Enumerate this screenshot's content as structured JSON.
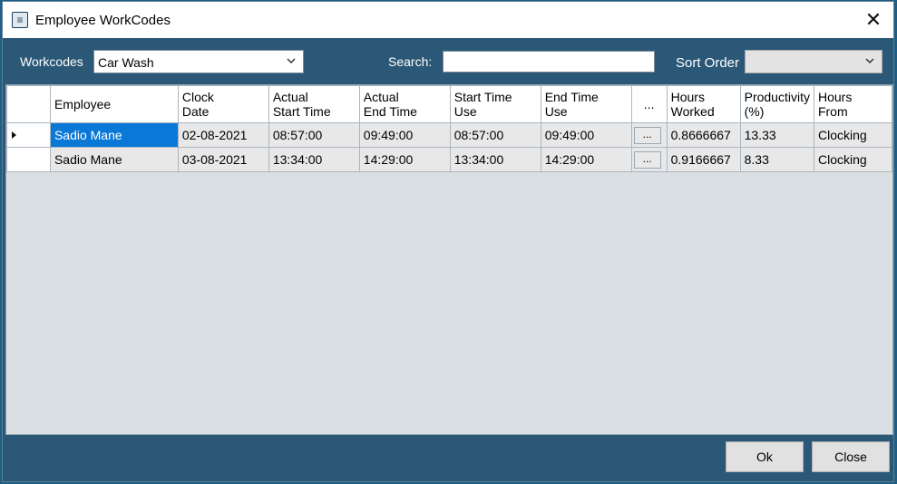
{
  "window": {
    "title": "Employee WorkCodes"
  },
  "toolbar": {
    "workcodes_label": "Workcodes",
    "workcodes_value": "Car Wash",
    "search_label": "Search:",
    "search_value": "",
    "sort_label": "Sort Order",
    "sort_value": ""
  },
  "grid": {
    "columns": [
      [
        "Employee"
      ],
      [
        "Clock",
        "Date"
      ],
      [
        "Actual",
        "Start Time"
      ],
      [
        "Actual",
        "End Time"
      ],
      [
        "Start Time",
        "Use"
      ],
      [
        "End Time",
        "Use"
      ],
      [
        "..."
      ],
      [
        "Hours",
        "Worked"
      ],
      [
        "Productivity",
        "(%)"
      ],
      [
        "Hours",
        "From"
      ]
    ],
    "rows": [
      {
        "employee": "Sadio Mane",
        "clock_date": "02-08-2021",
        "actual_start": "08:57:00",
        "actual_end": "09:49:00",
        "start_use": "08:57:00",
        "end_use": "09:49:00",
        "button": "...",
        "hours_worked": "0.8666667",
        "productivity": "13.33",
        "hours_from": "Clocking"
      },
      {
        "employee": "Sadio Mane",
        "clock_date": "03-08-2021",
        "actual_start": "13:34:00",
        "actual_end": "14:29:00",
        "start_use": "13:34:00",
        "end_use": "14:29:00",
        "button": "...",
        "hours_worked": "0.9166667",
        "productivity": "8.33",
        "hours_from": "Clocking"
      }
    ]
  },
  "buttons": {
    "ok": "Ok",
    "close": "Close"
  },
  "colors": {
    "frame": "#2b5877",
    "selection": "#0a78d7",
    "grid_bg": "#d9dfe3"
  }
}
